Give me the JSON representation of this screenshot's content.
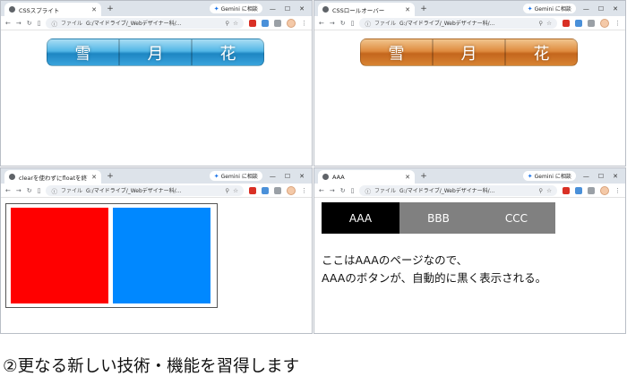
{
  "windows": [
    {
      "tab_title": "CSSスプライト",
      "url": "G:/マイドライブ/_Webデザイナー科/...",
      "buttons": [
        "雪",
        "月",
        "花"
      ]
    },
    {
      "tab_title": "CSSロールオーバー",
      "url": "G:/マイドライブ/_Webデザイナー科/...",
      "buttons": [
        "雪",
        "月",
        "花"
      ]
    },
    {
      "tab_title": "clearを使わずにfloatを終了する方",
      "url": "G:/マイドライブ/_Webデザイナー科/..."
    },
    {
      "tab_title": "AAA",
      "url": "G:/マイドライブ/_Webデザイナー科/...",
      "tabs": [
        "AAA",
        "BBB",
        "CCC"
      ],
      "message_line1": "ここはAAAのページなので、",
      "message_line2": "AAAのボタンが、自動的に黒く表示される。"
    }
  ],
  "browser": {
    "gemini_label": "Gemini に相談",
    "file_label": "ファイル",
    "new_tab": "+"
  },
  "caption": "②更なる新しい技術・機能を習得します",
  "colors": {
    "blue_sprite": "#3aa4dc",
    "orange_rollover": "#d88433",
    "float_red": "#ff0000",
    "float_blue": "#0088ff",
    "tab_active": "#000000",
    "tab_inactive": "#808080"
  }
}
